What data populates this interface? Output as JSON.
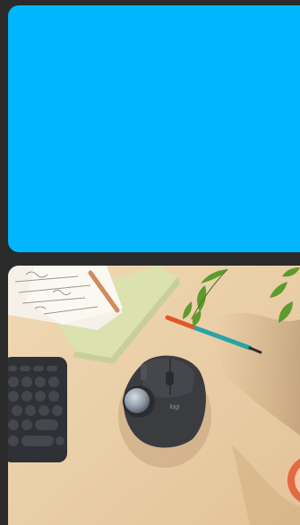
{
  "cards": [
    {
      "type": "color-block",
      "color": "#00B7FF"
    },
    {
      "type": "product-photo",
      "subject": "trackball-mouse-on-desk",
      "mouse_logo": "logi",
      "colors": {
        "desk": "#E9CFA8",
        "mouse": "#3A3C40",
        "keyboard": "#2F3136",
        "pen_body": "#2BA3A5",
        "pen_tip": "#E0572A",
        "notebook": "#DDE3B2",
        "plant": "#5E9A2E"
      }
    }
  ]
}
